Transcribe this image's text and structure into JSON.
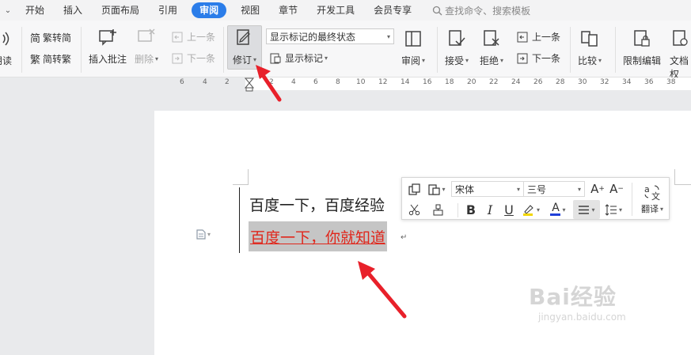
{
  "tabs": [
    {
      "label": "开始"
    },
    {
      "label": "插入"
    },
    {
      "label": "页面布局"
    },
    {
      "label": "引用"
    },
    {
      "label": "审阅"
    },
    {
      "label": "视图"
    },
    {
      "label": "章节"
    },
    {
      "label": "开发工具"
    },
    {
      "label": "会员专享"
    }
  ],
  "search": {
    "placeholder": "查找命令、搜索模板"
  },
  "ribbon": {
    "read_label": "朗读",
    "trad_label": "繁转简",
    "simp_label": "简转繁",
    "insert_comment": "插入批注",
    "delete": "删除",
    "prev_comment": "上一条",
    "next_comment": "下一条",
    "revise": "修订",
    "display_mode": "显示标记的最终状态",
    "show_markup": "显示标记",
    "review": "审阅",
    "accept": "接受",
    "reject": "拒绝",
    "prev_change": "上一条",
    "next_change": "下一条",
    "compare": "比较",
    "restrict": "限制编辑",
    "doc_rights": "文档权"
  },
  "ruler": {
    "numbers": [
      "6",
      "4",
      "2",
      "2",
      "4",
      "6",
      "8",
      "10",
      "12",
      "14",
      "16",
      "18",
      "20",
      "22",
      "24",
      "26",
      "28",
      "30",
      "32",
      "34",
      "36",
      "38"
    ]
  },
  "document": {
    "line1": "百度一下，百度经验",
    "line2": "百度一下，你就知道"
  },
  "mini_toolbar": {
    "font": "宋体",
    "size": "三号",
    "translate": "翻译"
  },
  "watermark": {
    "brand": "Bai经验",
    "url": "jingyan.baidu.com"
  },
  "colors": {
    "accent": "#2b7de9",
    "revision": "#e0261b",
    "arrow": "#e8202a"
  }
}
